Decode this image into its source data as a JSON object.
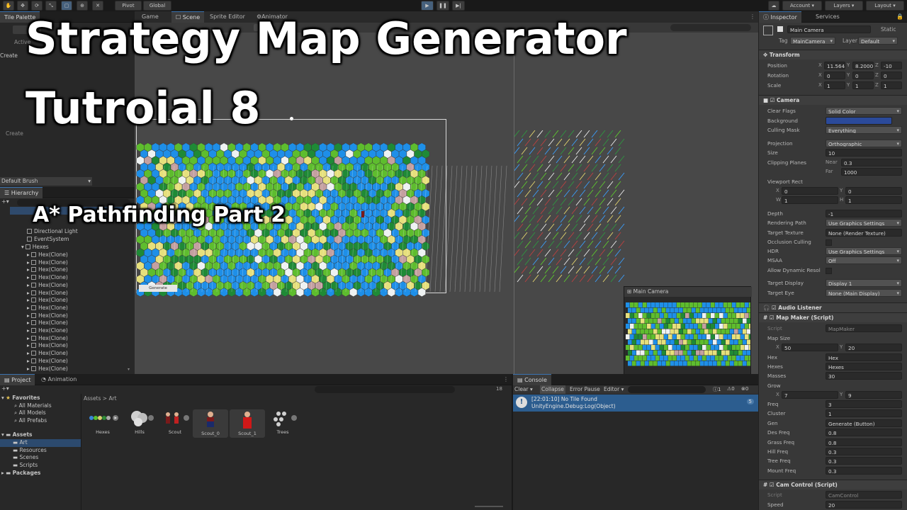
{
  "overlay": {
    "title_line1": "Strategy Map Generator",
    "title_line2": "Tutroial 8",
    "subtitle": "A* Pathfinding Part 2"
  },
  "toolbar": {
    "pivot": "Pivot",
    "global": "Global",
    "account": "Account",
    "layers": "Layers",
    "layout": "Layout"
  },
  "scene_tabs": [
    "Game",
    "Scene",
    "Sprite Editor",
    "Animator"
  ],
  "left_top": {
    "tab": "Tile Palette",
    "active_label": "Active",
    "create1": "Create",
    "create2": "Create",
    "brush": "Default Brush"
  },
  "hierarchy": {
    "tab": "Hierarchy",
    "items": [
      "Directional Light",
      "EventSystem",
      "Hexes"
    ],
    "clone_label": "Hex(Clone)",
    "clone_count": 16
  },
  "scene": {
    "generate_label": "Generate",
    "camera_preview_title": "Main Camera"
  },
  "inspector": {
    "tabs": [
      "Inspector",
      "Services"
    ],
    "object_name": "Main Camera",
    "static_label": "Static",
    "tag_label": "Tag",
    "tag_value": "MainCamera",
    "layer_label": "Layer",
    "layer_value": "Default",
    "transform": {
      "title": "Transform",
      "position": [
        "11.564",
        "8.2000",
        "-10"
      ],
      "rotation": [
        "0",
        "0",
        "0"
      ],
      "scale": [
        "1",
        "1",
        "1"
      ]
    },
    "camera": {
      "title": "Camera",
      "rows": [
        {
          "label": "Clear Flags",
          "value": "Solid Color"
        },
        {
          "label": "Background",
          "value": ""
        },
        {
          "label": "Culling Mask",
          "value": "Everything"
        },
        {
          "label": "Projection",
          "value": "Orthographic"
        },
        {
          "label": "Size",
          "value": "10"
        },
        {
          "label": "Clipping Planes",
          "value": ""
        }
      ],
      "near": "0.3",
      "far": "1000",
      "viewport_label": "Viewport Rect",
      "viewport": [
        "0",
        "0",
        "1",
        "1"
      ],
      "rows2": [
        {
          "label": "Depth",
          "value": "-1"
        },
        {
          "label": "Rendering Path",
          "value": "Use Graphics Settings"
        },
        {
          "label": "Target Texture",
          "value": "None (Render Texture)"
        },
        {
          "label": "Occlusion Culling",
          "value": ""
        },
        {
          "label": "HDR",
          "value": "Use Graphics Settings"
        },
        {
          "label": "MSAA",
          "value": "Off"
        },
        {
          "label": "Allow Dynamic Resol",
          "value": ""
        },
        {
          "label": "Target Display",
          "value": "Display 1"
        },
        {
          "label": "Target Eye",
          "value": "None (Main Display)"
        }
      ]
    },
    "audio_title": "Audio Listener",
    "mapmaker": {
      "title": "Map Maker (Script)",
      "script": "MapMaker",
      "map_size_label": "Map Size",
      "map_size": [
        "50",
        "20"
      ],
      "rows": [
        {
          "label": "Hex",
          "value": "Hex"
        },
        {
          "label": "Hexes",
          "value": "Hexes"
        },
        {
          "label": "Masses",
          "value": "30"
        }
      ],
      "grow_label": "Grow",
      "grow": [
        "7",
        "9"
      ],
      "rows2": [
        {
          "label": "Freq",
          "value": "3"
        },
        {
          "label": "Cluster",
          "value": "1"
        },
        {
          "label": "Gen",
          "value": "Generate (Button)"
        },
        {
          "label": "Des Freq",
          "value": "0.8"
        },
        {
          "label": "Grass Freq",
          "value": "0.8"
        },
        {
          "label": "Hill Freq",
          "value": "0.3"
        },
        {
          "label": "Tree Freq",
          "value": "0.3"
        },
        {
          "label": "Mount Freq",
          "value": "0.3"
        }
      ]
    },
    "camcontrol": {
      "title": "Cam Control (Script)",
      "script": "CamControl",
      "speed_label": "Speed",
      "speed": "20"
    }
  },
  "project": {
    "tabs": [
      "Project",
      "Animation"
    ],
    "favorites": "Favorites",
    "fav_items": [
      "All Materials",
      "All Models",
      "All Prefabs"
    ],
    "assets": "Assets",
    "asset_items": [
      "Art",
      "Resources",
      "Scenes",
      "Scripts"
    ],
    "packages": "Packages",
    "breadcrumb": "Assets > Art",
    "count": "18",
    "grid": [
      "Hexes",
      "Hills",
      "Scout",
      "Scout_0",
      "Scout_1",
      "Trees"
    ]
  },
  "console": {
    "tab": "Console",
    "buttons": [
      "Clear",
      "Collapse",
      "Error Pause",
      "Editor"
    ],
    "counts": [
      "1",
      "0",
      "0"
    ],
    "log_line1": "[22:01:10] No Tile Found",
    "log_line2": "UnityEngine.Debug:Log(Object)",
    "log_count": "5"
  },
  "colors": {
    "water": "#1e8fe8",
    "grass": "#5ebd2e",
    "desert": "#e6e07c",
    "forest": "#1f8a36",
    "hill": "#c4a0a0",
    "snow": "#eef2f2",
    "accent": "#3a72b0"
  }
}
